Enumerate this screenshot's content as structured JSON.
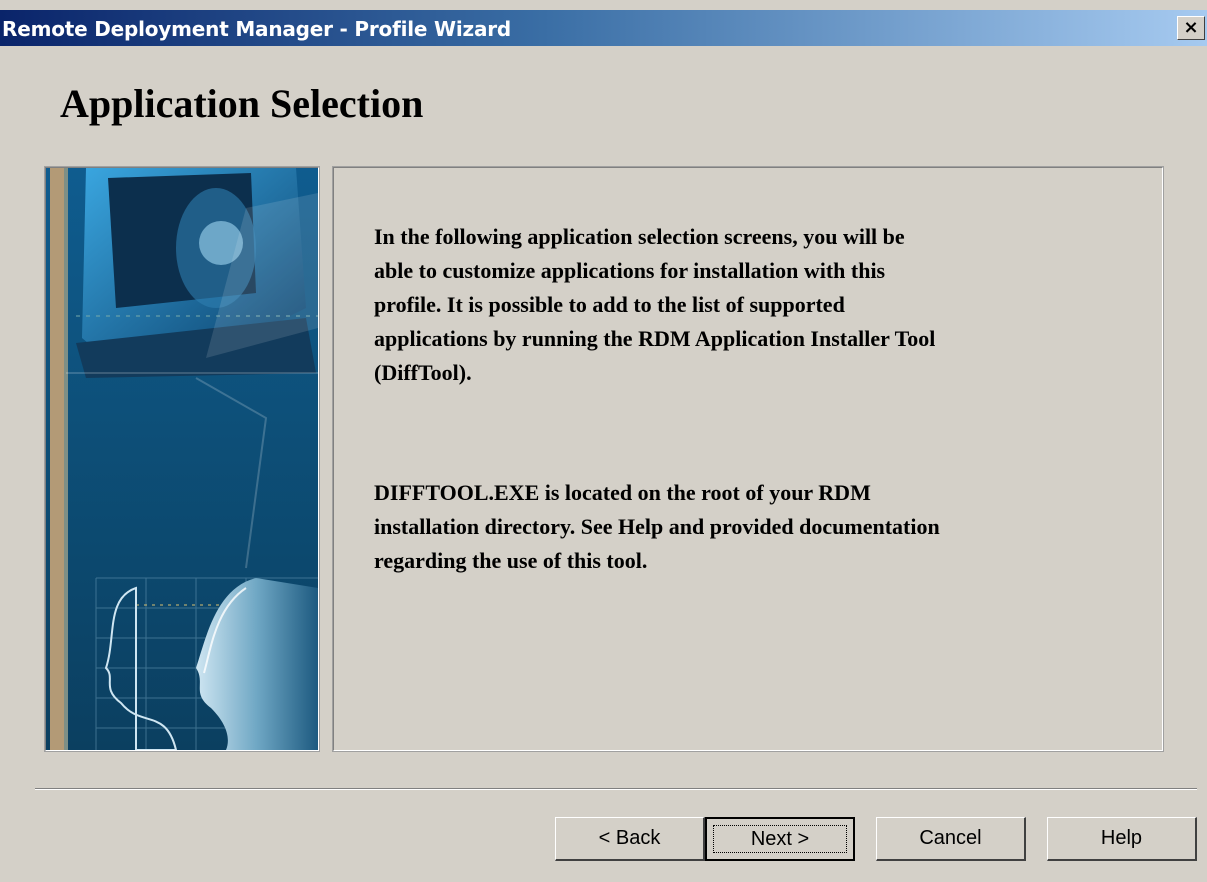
{
  "window": {
    "title": "Remote Deployment Manager - Profile Wizard",
    "close_glyph": "×",
    "close_icon": "close-icon"
  },
  "page": {
    "heading": "Application Selection"
  },
  "content": {
    "paragraph1": "In the following application selection screens, you will be\nable to customize applications for installation with this\nprofile.  It is possible to add to the list of supported\napplications by running the RDM Application Installer Tool\n(DiffTool).",
    "paragraph2": "DIFFTOOL.EXE is located on the root of your RDM\ninstallation directory.  See Help and provided documentation\nregarding the use of this tool."
  },
  "buttons": {
    "back": "< Back",
    "next": "Next >",
    "cancel": "Cancel",
    "help": "Help"
  },
  "colors": {
    "face": "#d4d0c8",
    "title_start": "#0a246a",
    "title_end": "#a6caf0",
    "illustration_blue": "#1b5f8a"
  }
}
